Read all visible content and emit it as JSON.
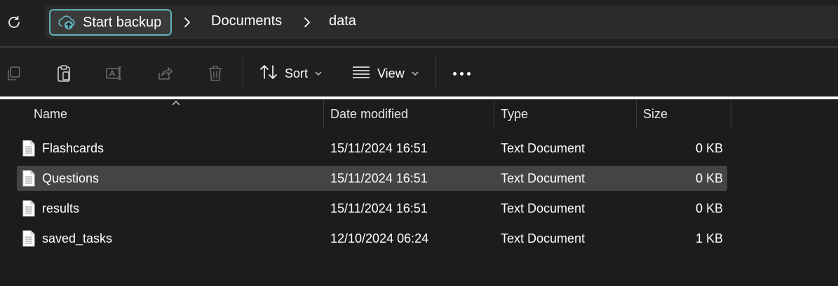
{
  "address_bar": {
    "backup_label": "Start backup",
    "breadcrumbs": [
      "Documents",
      "data"
    ]
  },
  "toolbar": {
    "sort_label": "Sort",
    "view_label": "View"
  },
  "columns": {
    "name": "Name",
    "date": "Date modified",
    "type": "Type",
    "size": "Size"
  },
  "files": [
    {
      "name": "Flashcards",
      "date": "15/11/2024 16:51",
      "type": "Text Document",
      "size": "0 KB",
      "selected": false
    },
    {
      "name": "Questions",
      "date": "15/11/2024 16:51",
      "type": "Text Document",
      "size": "0 KB",
      "selected": true
    },
    {
      "name": "results",
      "date": "15/11/2024 16:51",
      "type": "Text Document",
      "size": "0 KB",
      "selected": false
    },
    {
      "name": "saved_tasks",
      "date": "12/10/2024 06:24",
      "type": "Text Document",
      "size": "1 KB",
      "selected": false
    }
  ],
  "colors": {
    "accent": "#5fb2b9",
    "selection": "#444444",
    "background": "#1c1c1c"
  }
}
